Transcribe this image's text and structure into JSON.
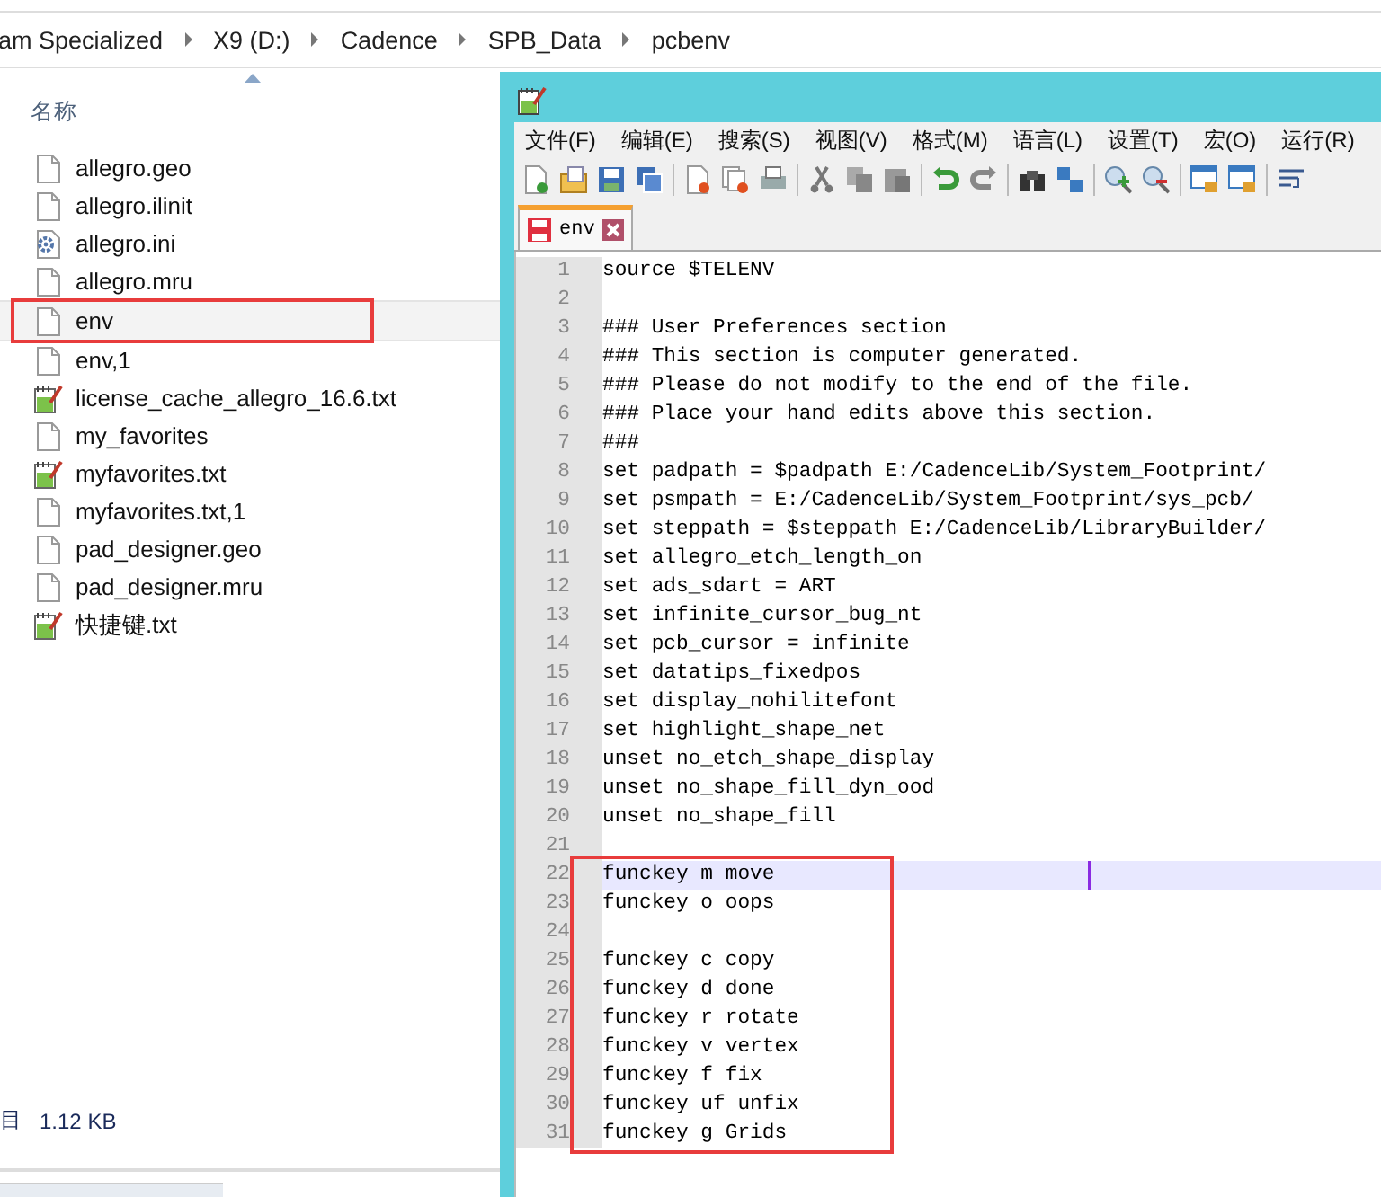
{
  "breadcrumb": [
    "am Specialized",
    "X9 (D:)",
    "Cadence",
    "SPB_Data",
    "pcbenv"
  ],
  "explorer": {
    "column_header": "名称",
    "files": [
      {
        "name": "allegro.geo",
        "kind": "blank",
        "hovered": false,
        "marked": false
      },
      {
        "name": "allegro.ilinit",
        "kind": "blank",
        "hovered": false,
        "marked": false
      },
      {
        "name": "allegro.ini",
        "kind": "settings",
        "hovered": false,
        "marked": false
      },
      {
        "name": "allegro.mru",
        "kind": "blank",
        "hovered": false,
        "marked": false
      },
      {
        "name": "env",
        "kind": "blank",
        "hovered": true,
        "marked": true
      },
      {
        "name": "env,1",
        "kind": "blank",
        "hovered": false,
        "marked": false
      },
      {
        "name": "license_cache_allegro_16.6.txt",
        "kind": "text",
        "hovered": false,
        "marked": false
      },
      {
        "name": "my_favorites",
        "kind": "blank",
        "hovered": false,
        "marked": false
      },
      {
        "name": "myfavorites.txt",
        "kind": "text",
        "hovered": false,
        "marked": false
      },
      {
        "name": "myfavorites.txt,1",
        "kind": "blank",
        "hovered": false,
        "marked": false
      },
      {
        "name": "pad_designer.geo",
        "kind": "blank",
        "hovered": false,
        "marked": false
      },
      {
        "name": "pad_designer.mru",
        "kind": "blank",
        "hovered": false,
        "marked": false
      },
      {
        "name": "快捷键.txt",
        "kind": "text",
        "hovered": false,
        "marked": false
      }
    ],
    "status": [
      "目",
      "1.12 KB"
    ]
  },
  "editor": {
    "menu": [
      "文件(F)",
      "编辑(E)",
      "搜索(S)",
      "视图(V)",
      "格式(M)",
      "语言(L)",
      "设置(T)",
      "宏(O)",
      "运行(R)"
    ],
    "tabs": [
      {
        "label": "env",
        "selected": true,
        "modified": true
      }
    ],
    "sections": [
      {
        "boxed": false,
        "lines": [
          {
            "num": "1",
            "text": "source $TELENV",
            "current": false
          },
          {
            "num": "2",
            "current": false
          },
          {
            "num": "3",
            "text": "### User Preferences section",
            "current": false
          },
          {
            "num": "4",
            "text": "### This section is computer generated.",
            "current": false
          },
          {
            "num": "5",
            "text": "### Please do not modify to the end of the file.",
            "current": false
          },
          {
            "num": "6",
            "text": "### Place your hand edits above this section.",
            "current": false
          },
          {
            "num": "7",
            "text": "###",
            "current": false
          },
          {
            "num": "8",
            "text": "set padpath = $padpath E:/CadenceLib/System_Footprint/",
            "current": false
          },
          {
            "num": "9",
            "text": "set psmpath = E:/CadenceLib/System_Footprint/sys_pcb/",
            "current": false
          },
          {
            "num": "10",
            "text": "set steppath = $steppath E:/CadenceLib/LibraryBuilder/",
            "current": false
          },
          {
            "num": "11",
            "text": "set allegro_etch_length_on",
            "current": false
          },
          {
            "num": "12",
            "text": "set ads_sdart = ART",
            "current": false
          },
          {
            "num": "13",
            "text": "set infinite_cursor_bug_nt",
            "current": false
          },
          {
            "num": "14",
            "text": "set pcb_cursor = infinite",
            "current": false
          },
          {
            "num": "15",
            "text": "set datatips_fixedpos",
            "current": false
          },
          {
            "num": "16",
            "text": "set display_nohilitefont",
            "current": false
          },
          {
            "num": "17",
            "text": "set highlight_shape_net",
            "current": false
          },
          {
            "num": "18",
            "text": "unset no_etch_shape_display",
            "current": false
          },
          {
            "num": "19",
            "text": "unset no_shape_fill_dyn_ood",
            "current": false
          },
          {
            "num": "20",
            "text": "unset no_shape_fill",
            "current": false
          },
          {
            "num": "21",
            "current": false
          }
        ]
      },
      {
        "boxed": true,
        "lines": [
          {
            "num": "22",
            "text": "funckey m move",
            "current": true
          },
          {
            "num": "23",
            "text": "funckey o oops",
            "current": false
          },
          {
            "num": "24",
            "current": false
          },
          {
            "num": "25",
            "text": "funckey c copy",
            "current": false
          },
          {
            "num": "26",
            "text": "funckey d done",
            "current": false
          },
          {
            "num": "27",
            "text": "funckey r rotate",
            "current": false
          },
          {
            "num": "28",
            "text": "funckey v vertex",
            "current": false
          },
          {
            "num": "29",
            "text": "funckey f fix",
            "current": false
          },
          {
            "num": "30",
            "text": "funckey uf unfix",
            "current": false
          },
          {
            "num": "31",
            "text": "funckey g Grids",
            "current": false
          }
        ]
      }
    ]
  }
}
